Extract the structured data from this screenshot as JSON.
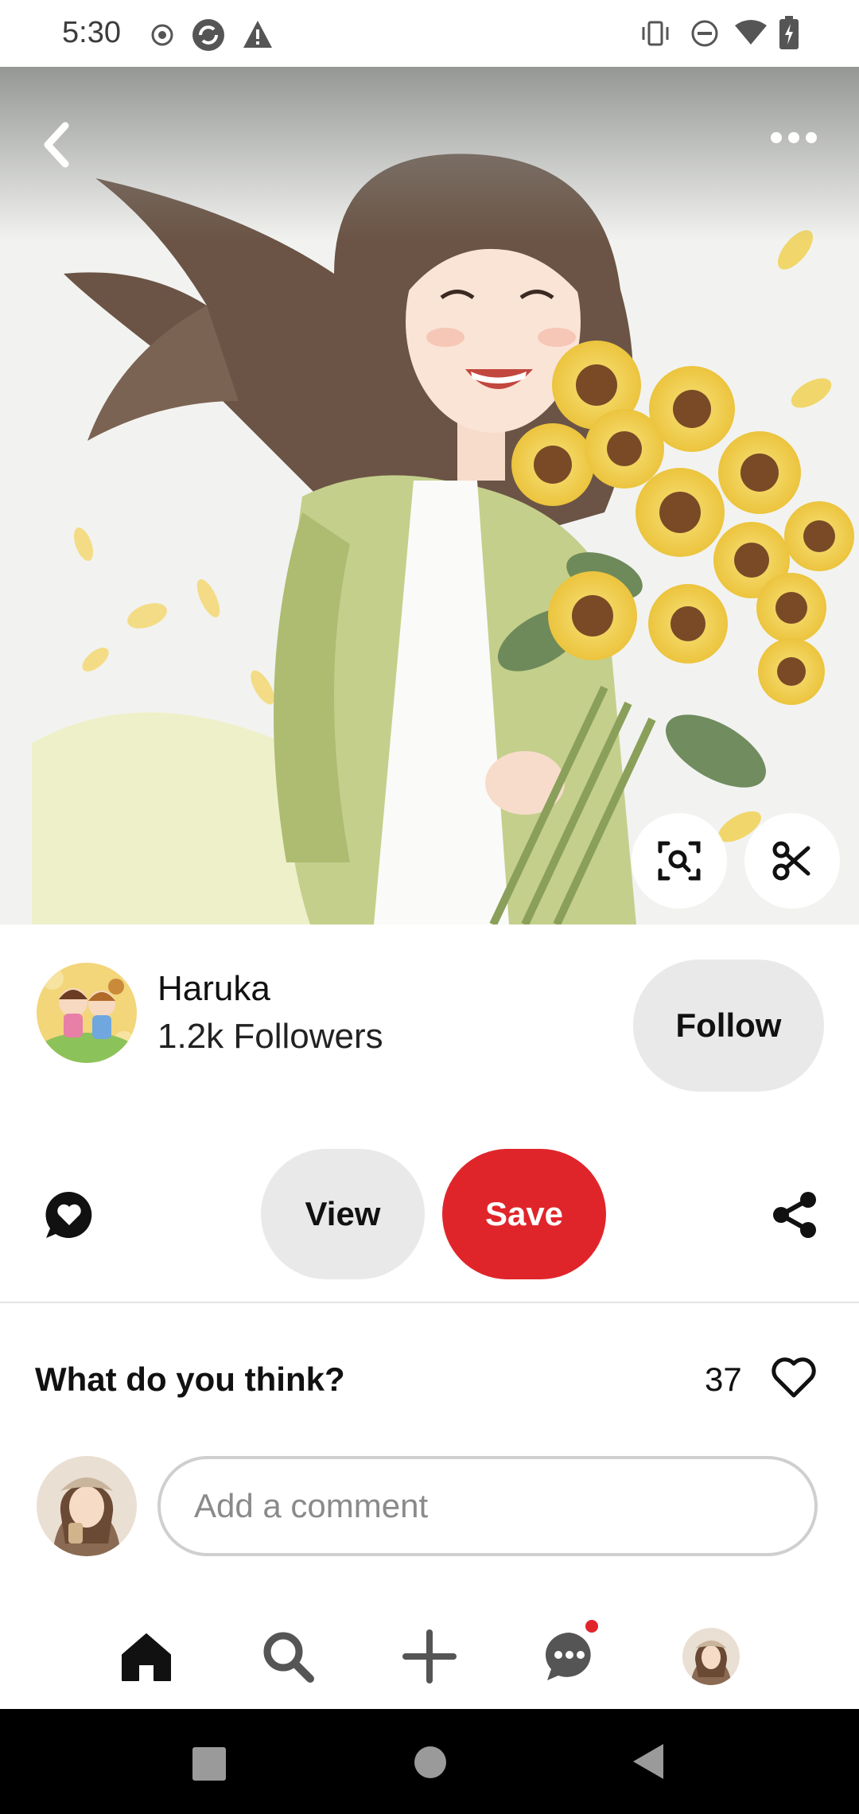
{
  "status_bar": {
    "time": "5:30",
    "left_icons": [
      "record-icon",
      "sync-icon",
      "warning-icon"
    ],
    "right_icons": [
      "vibrate-icon",
      "do-not-disturb-icon",
      "wifi-icon",
      "battery-icon"
    ]
  },
  "pin": {
    "image_subject": "anime girl holding sunflowers",
    "top_actions": [
      "back-icon",
      "more-icon"
    ],
    "overlay_actions": [
      "visual-search-icon",
      "scissors-icon"
    ]
  },
  "author": {
    "name": "Haruka",
    "followers": "1.2k Followers",
    "follow_label": "Follow"
  },
  "actions": {
    "view_label": "View",
    "save_label": "Save",
    "accent": "#e0252a"
  },
  "comments": {
    "prompt": "What do you think?",
    "count": "37",
    "input_placeholder": "Add a comment"
  },
  "bottom_nav": {
    "items": [
      "home-icon",
      "search-icon",
      "create-icon",
      "messages-icon",
      "profile-avatar"
    ],
    "active": "home"
  }
}
